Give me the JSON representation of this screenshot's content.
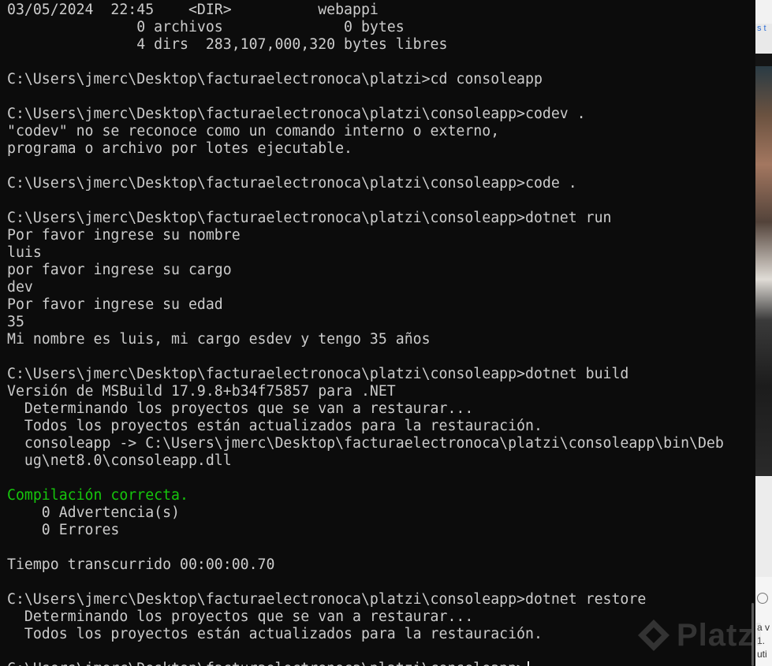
{
  "terminal": {
    "lines": [
      {
        "text": "03/05/2024  22:45    <DIR>          webappi"
      },
      {
        "text": "               0 archivos              0 bytes"
      },
      {
        "text": "               4 dirs  283,107,000,320 bytes libres"
      },
      {
        "text": ""
      },
      {
        "text": "C:\\Users\\jmerc\\Desktop\\facturaelectronoca\\platzi>cd consoleapp"
      },
      {
        "text": ""
      },
      {
        "text": "C:\\Users\\jmerc\\Desktop\\facturaelectronoca\\platzi\\consoleapp>codev ."
      },
      {
        "text": "\"codev\" no se reconoce como un comando interno o externo,"
      },
      {
        "text": "programa o archivo por lotes ejecutable."
      },
      {
        "text": ""
      },
      {
        "text": "C:\\Users\\jmerc\\Desktop\\facturaelectronoca\\platzi\\consoleapp>code ."
      },
      {
        "text": ""
      },
      {
        "text": "C:\\Users\\jmerc\\Desktop\\facturaelectronoca\\platzi\\consoleapp>dotnet run"
      },
      {
        "text": "Por favor ingrese su nombre"
      },
      {
        "text": "luis"
      },
      {
        "text": "por favor ingrese su cargo"
      },
      {
        "text": "dev"
      },
      {
        "text": "Por favor ingrese su edad"
      },
      {
        "text": "35"
      },
      {
        "text": "Mi nombre es luis, mi cargo esdev y tengo 35 años"
      },
      {
        "text": ""
      },
      {
        "text": "C:\\Users\\jmerc\\Desktop\\facturaelectronoca\\platzi\\consoleapp>dotnet build"
      },
      {
        "text": "Versión de MSBuild 17.9.8+b34f75857 para .NET"
      },
      {
        "text": "  Determinando los proyectos que se van a restaurar..."
      },
      {
        "text": "  Todos los proyectos están actualizados para la restauración."
      },
      {
        "text": "  consoleapp -> C:\\Users\\jmerc\\Desktop\\facturaelectronoca\\platzi\\consoleapp\\bin\\Deb"
      },
      {
        "text": "  ug\\net8.0\\consoleapp.dll"
      },
      {
        "text": ""
      },
      {
        "text": "Compilación correcta.",
        "color": "#16c60c"
      },
      {
        "text": "    0 Advertencia(s)"
      },
      {
        "text": "    0 Errores"
      },
      {
        "text": ""
      },
      {
        "text": "Tiempo transcurrido 00:00:00.70"
      },
      {
        "text": ""
      },
      {
        "text": "C:\\Users\\jmerc\\Desktop\\facturaelectronoca\\platzi\\consoleapp>dotnet restore"
      },
      {
        "text": "  Determinando los proyectos que se van a restaurar..."
      },
      {
        "text": "  Todos los proyectos están actualizados para la restauración."
      },
      {
        "text": ""
      },
      {
        "text": "C:\\Users\\jmerc\\Desktop\\facturaelectronoca\\platzi\\consoleapp>",
        "cursor": true
      }
    ]
  },
  "colors": {
    "background": "#0c0c0c",
    "foreground": "#cccccc",
    "success": "#16c60c"
  },
  "background_window": {
    "link_fragment": "s t",
    "text_fragment": "a v\n1.\nuti"
  },
  "watermark": {
    "brand": "Platzi",
    "icon": "platzi-logo-icon"
  }
}
